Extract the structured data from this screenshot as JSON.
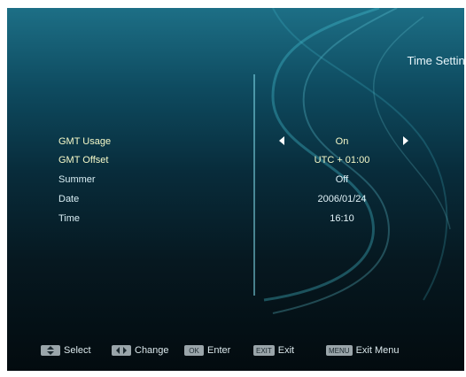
{
  "screen": {
    "title": "Time Setting"
  },
  "settings": [
    {
      "label": "GMT Usage",
      "value": "On",
      "highlight": true,
      "arrows": true
    },
    {
      "label": "GMT Offset",
      "value": "UTC + 01:00",
      "highlight": true,
      "arrows": false
    },
    {
      "label": "Summer",
      "value": "Off",
      "highlight": false,
      "arrows": false
    },
    {
      "label": "Date",
      "value": "2006/01/24",
      "highlight": false,
      "arrows": false
    },
    {
      "label": "Time",
      "value": "16:10",
      "highlight": false,
      "arrows": false
    }
  ],
  "help_bar": [
    {
      "key_icon": "up-down-arrows-icon",
      "key_text": "",
      "label": "Select"
    },
    {
      "key_icon": "left-right-arrows-icon",
      "key_text": "",
      "label": "Change"
    },
    {
      "key_icon": "",
      "key_text": "OK",
      "label": "Enter"
    },
    {
      "key_icon": "",
      "key_text": "EXIT",
      "label": "Exit"
    },
    {
      "key_icon": "",
      "key_text": "MENU",
      "label": "Exit Menu"
    }
  ],
  "colors": {
    "accent_highlight": "#f5f9c8",
    "swirl": "#49c6d8"
  }
}
